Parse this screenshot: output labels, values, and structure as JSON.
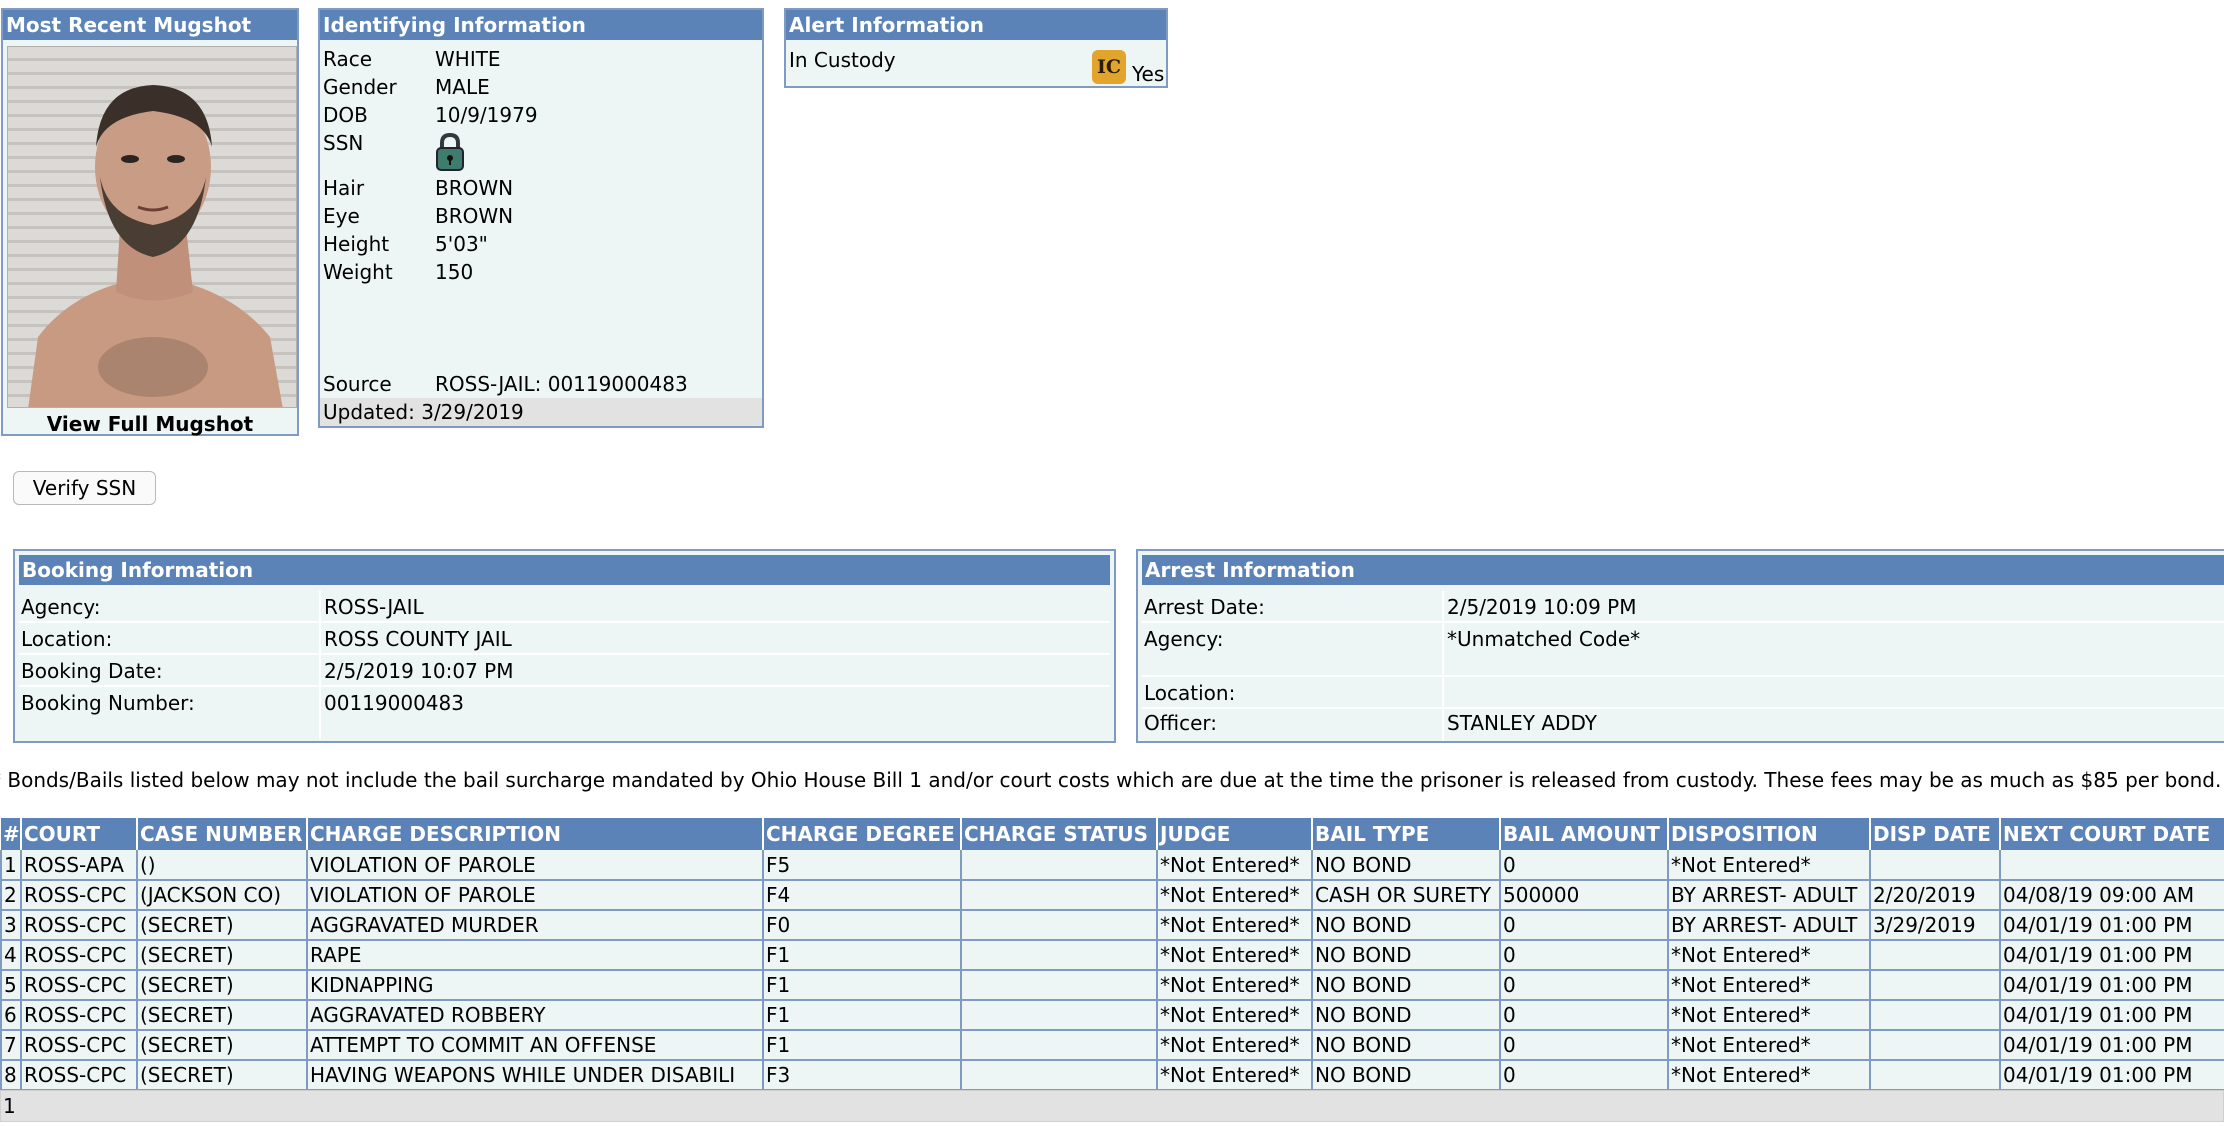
{
  "mugshot": {
    "title": "Most Recent Mugshot",
    "link_label": "View Full Mugshot"
  },
  "identifying": {
    "title": "Identifying Information",
    "fields": [
      {
        "label": "Race",
        "value": "WHITE"
      },
      {
        "label": "Gender",
        "value": "MALE"
      },
      {
        "label": "DOB",
        "value": "10/9/1979"
      },
      {
        "label": "SSN",
        "value": ""
      },
      {
        "label": "Hair",
        "value": "BROWN"
      },
      {
        "label": "Eye",
        "value": "BROWN"
      },
      {
        "label": "Height",
        "value": "5'03\""
      },
      {
        "label": "Weight",
        "value": "150"
      }
    ],
    "source_label": "Source",
    "source_value": "ROSS-JAIL: 00119000483",
    "updated": "Updated: 3/29/2019",
    "ssn_icon": "lock-icon"
  },
  "alert": {
    "title": "Alert Information",
    "label": "In Custody",
    "icon_text": "IC",
    "value": "Yes"
  },
  "verify_ssn_label": "Verify SSN",
  "booking": {
    "title": "Booking Information",
    "rows": [
      {
        "label": "Agency:",
        "value": "ROSS-JAIL"
      },
      {
        "label": "Location:",
        "value": "ROSS COUNTY JAIL"
      },
      {
        "label": "Booking Date:",
        "value": "2/5/2019 10:07 PM"
      },
      {
        "label": "Booking Number:",
        "value": "00119000483"
      }
    ]
  },
  "arrest": {
    "title": "Arrest Information",
    "rows": [
      {
        "label": "Arrest Date:",
        "value": "2/5/2019 10:09 PM"
      },
      {
        "label": "Agency:",
        "value": "*Unmatched Code*"
      },
      {
        "label": "Location:",
        "value": ""
      },
      {
        "label": "Officer:",
        "value": "STANLEY ADDY"
      }
    ]
  },
  "disclaimer": "* Bonds/Bails listed below may not include the bail surcharge mandated by Ohio House Bill 1 and/or court costs which are due at the time the prisoner is released from custody. These fees may be as much as $85 per bond.",
  "charges": {
    "headers": [
      "#",
      "COURT",
      "CASE NUMBER",
      "CHARGE DESCRIPTION",
      "CHARGE DEGREE",
      "CHARGE STATUS",
      "JUDGE",
      "BAIL TYPE",
      "BAIL AMOUNT",
      "DISPOSITION",
      "DISP DATE",
      "NEXT COURT DATE"
    ],
    "rows": [
      [
        "1",
        "ROSS-APA",
        "()",
        "VIOLATION OF PAROLE",
        "F5",
        "",
        "*Not Entered*",
        "NO BOND",
        "0",
        "*Not Entered*",
        "",
        ""
      ],
      [
        "2",
        "ROSS-CPC",
        "(JACKSON CO)",
        "VIOLATION OF PAROLE",
        "F4",
        "",
        "*Not Entered*",
        "CASH OR SURETY",
        "500000",
        "BY ARREST- ADULT",
        "2/20/2019",
        "04/08/19 09:00 AM"
      ],
      [
        "3",
        "ROSS-CPC",
        "(SECRET)",
        "AGGRAVATED MURDER",
        "F0",
        "",
        "*Not Entered*",
        "NO BOND",
        "0",
        "BY ARREST- ADULT",
        "3/29/2019",
        "04/01/19 01:00 PM"
      ],
      [
        "4",
        "ROSS-CPC",
        "(SECRET)",
        "RAPE",
        "F1",
        "",
        "*Not Entered*",
        "NO BOND",
        "0",
        "*Not Entered*",
        "",
        "04/01/19 01:00 PM"
      ],
      [
        "5",
        "ROSS-CPC",
        "(SECRET)",
        "KIDNAPPING",
        "F1",
        "",
        "*Not Entered*",
        "NO BOND",
        "0",
        "*Not Entered*",
        "",
        "04/01/19 01:00 PM"
      ],
      [
        "6",
        "ROSS-CPC",
        "(SECRET)",
        "AGGRAVATED ROBBERY",
        "F1",
        "",
        "*Not Entered*",
        "NO BOND",
        "0",
        "*Not Entered*",
        "",
        "04/01/19 01:00 PM"
      ],
      [
        "7",
        "ROSS-CPC",
        "(SECRET)",
        "ATTEMPT TO COMMIT AN OFFENSE",
        "F1",
        "",
        "*Not Entered*",
        "NO BOND",
        "0",
        "*Not Entered*",
        "",
        "04/01/19 01:00 PM"
      ],
      [
        "8",
        "ROSS-CPC",
        "(SECRET)",
        "HAVING WEAPONS WHILE UNDER DISABILI",
        "F3",
        "",
        "*Not Entered*",
        "NO BOND",
        "0",
        "*Not Entered*",
        "",
        "04/01/19 01:00 PM"
      ]
    ],
    "footer": "1"
  }
}
